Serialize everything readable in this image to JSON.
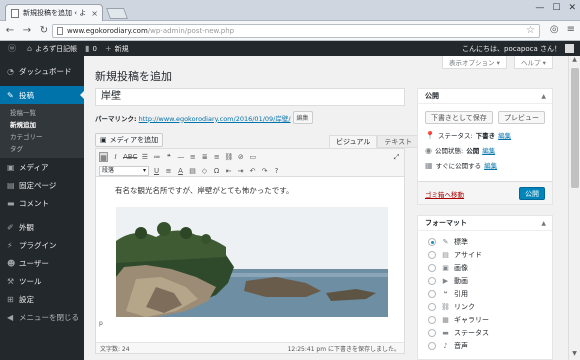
{
  "browser": {
    "tab_title": "新規投稿を追加 ‹ よろず日記",
    "url_prefix": "www.egokorodiary.com",
    "url_path": "/wp-admin/post-new.php"
  },
  "adminbar": {
    "site_name": "よろず日記帳",
    "comments_count": "0",
    "new_label": "新規",
    "greeting": "こんにちは、pocapoca さん！"
  },
  "sidebar": {
    "items": [
      {
        "label": "ダッシュボード"
      },
      {
        "label": "投稿"
      },
      {
        "label": "メディア"
      },
      {
        "label": "固定ページ"
      },
      {
        "label": "コメント"
      },
      {
        "label": "外観"
      },
      {
        "label": "プラグイン"
      },
      {
        "label": "ユーザー"
      },
      {
        "label": "ツール"
      },
      {
        "label": "設定"
      },
      {
        "label": "メニューを閉じる"
      }
    ],
    "submenu": [
      "投稿一覧",
      "新規追加",
      "カテゴリー",
      "タグ"
    ]
  },
  "screen_options": {
    "display": "表示オプション ▾",
    "help": "ヘルプ ▾"
  },
  "page_title": "新規投稿を追加",
  "post": {
    "title": "岸壁",
    "permalink_label": "パーマリンク:",
    "permalink_url": "http://www.egokorodiary.com/2016/01/09/岸壁/",
    "edit_btn": "編集",
    "body_text": "有名な観光名所ですが、岸壁がとても怖かったです。",
    "path": "p",
    "word_count": "文字数: 24",
    "draft_saved": "12:25:41 pm に下書きを保存しました。"
  },
  "editor": {
    "add_media": "メディアを追加",
    "tab_visual": "ビジュアル",
    "tab_text": "テキスト",
    "paragraph": "段落"
  },
  "publish": {
    "title": "公開",
    "save_draft": "下書きとして保存",
    "preview": "プレビュー",
    "status_label": "ステータス:",
    "status_value": "下書き",
    "visibility_label": "公開状態:",
    "visibility_value": "公開",
    "schedule_label": "すぐに公開する",
    "edit": "編集",
    "trash": "ゴミ箱へ移動",
    "publish_btn": "公開"
  },
  "format": {
    "title": "フォーマット",
    "items": [
      "標準",
      "アサイド",
      "画像",
      "動画",
      "引用",
      "リンク",
      "ギャラリー",
      "ステータス",
      "音声"
    ]
  }
}
